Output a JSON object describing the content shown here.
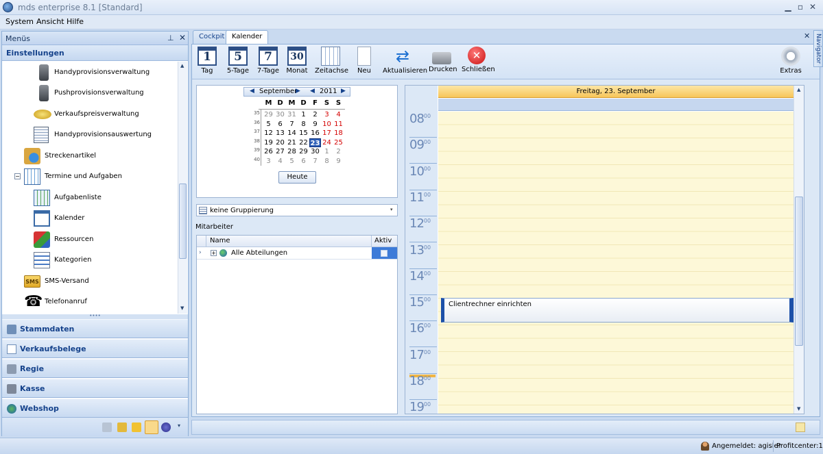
{
  "window": {
    "title": "mds enterprise 8.1 [Standard]"
  },
  "menu": [
    "System",
    "Ansicht",
    "Hilfe"
  ],
  "left": {
    "header": "Menüs",
    "section": "Einstellungen",
    "items": [
      {
        "label": "Handyprovisionsverwaltung",
        "icon": "mobile-phone-icon"
      },
      {
        "label": "Pushprovisionsverwaltung",
        "icon": "mobile-phone-icon"
      },
      {
        "label": "Verkaufspreisverwaltung",
        "icon": "coins-icon"
      },
      {
        "label": "Handyprovisionsauswertung",
        "icon": "mobile-report-icon"
      },
      {
        "label": "Streckenartikel",
        "icon": "globe-box-icon"
      },
      {
        "label": "Termine und Aufgaben",
        "icon": "calendar-grid-icon"
      },
      {
        "label": "Aufgabenliste",
        "icon": "task-list-icon"
      },
      {
        "label": "Kalender",
        "icon": "calendar-clock-icon"
      },
      {
        "label": "Ressourcen",
        "icon": "resources-cubes-icon"
      },
      {
        "label": "Kategorien",
        "icon": "categories-icon"
      },
      {
        "label": "SMS-Versand",
        "icon": "sms-icon"
      },
      {
        "label": "Telefonanruf",
        "icon": "telephone-icon"
      }
    ],
    "groups": [
      "Stammdaten",
      "Verkaufsbelege",
      "Regie",
      "Kasse",
      "Webshop"
    ]
  },
  "tabs": [
    "Cockpit",
    "Kalender"
  ],
  "toolbar": [
    {
      "label": "Tag",
      "glyph": "1"
    },
    {
      "label": "5-Tage",
      "glyph": "5"
    },
    {
      "label": "7-Tage",
      "glyph": "7"
    },
    {
      "label": "Monat",
      "glyph": "30"
    },
    {
      "label": "Zeitachse"
    },
    {
      "label": "Neu"
    },
    {
      "label": "Aktualisieren"
    },
    {
      "label": "Drucken"
    },
    {
      "label": "Schließen"
    },
    {
      "label": "Extras"
    }
  ],
  "minical": {
    "month": "September",
    "year": "2011",
    "weekdays": [
      "M",
      "D",
      "M",
      "D",
      "F",
      "S",
      "S"
    ],
    "weeks": [
      {
        "wk": "35",
        "days": [
          "29",
          "30",
          "31",
          "1",
          "2",
          "3",
          "4"
        ]
      },
      {
        "wk": "36",
        "days": [
          "5",
          "6",
          "7",
          "8",
          "9",
          "10",
          "11"
        ]
      },
      {
        "wk": "37",
        "days": [
          "12",
          "13",
          "14",
          "15",
          "16",
          "17",
          "18"
        ]
      },
      {
        "wk": "38",
        "days": [
          "19",
          "20",
          "21",
          "22",
          "23",
          "24",
          "25"
        ]
      },
      {
        "wk": "39",
        "days": [
          "26",
          "27",
          "28",
          "29",
          "30",
          "1",
          "2"
        ]
      },
      {
        "wk": "40",
        "days": [
          "3",
          "4",
          "5",
          "6",
          "7",
          "8",
          "9"
        ]
      }
    ],
    "today_btn": "Heute"
  },
  "grouping": "keine Gruppierung",
  "mitarbeiter_label": "Mitarbeiter",
  "grid": {
    "col_name": "Name",
    "col_active": "Aktiv",
    "row": "Alle Abteilungen"
  },
  "day": {
    "header": "Freitag, 23. September",
    "hours": [
      "08",
      "09",
      "10",
      "11",
      "12",
      "13",
      "14",
      "15",
      "16",
      "17",
      "18",
      "19"
    ],
    "minutes": "00",
    "appointment": "Clientrechner einrichten"
  },
  "navigator": "Navigator",
  "status": {
    "user": "Angemeldet: agisler",
    "center": "Profitcenter:1"
  }
}
